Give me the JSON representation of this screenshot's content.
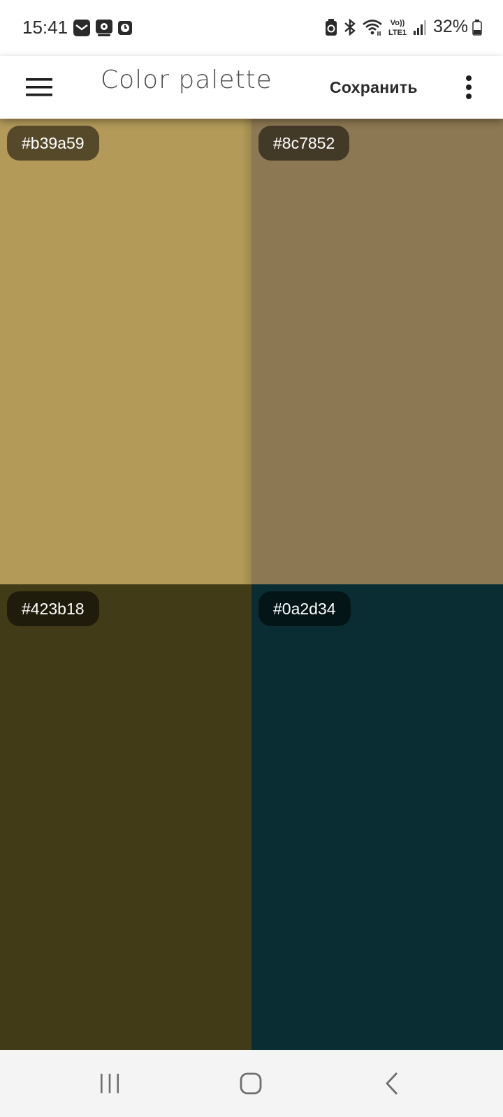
{
  "status_bar": {
    "time": "15:41",
    "left_icons": [
      "mail-icon",
      "gallery-icon",
      "clock-app-icon"
    ],
    "right_icons": [
      "battery-saver-icon",
      "bluetooth-icon",
      "wifi-icon",
      "volte-icon",
      "signal-icon",
      "battery-icon"
    ],
    "volte_label": "Vo)) LTE1",
    "battery": "32%"
  },
  "app_bar": {
    "menu_icon": "menu-icon",
    "title": "Color palette",
    "save_label": "Сохранить",
    "more_icon": "more-vert-icon"
  },
  "palette": {
    "colors": [
      {
        "hex_label": "#b39a59",
        "color": "#b39a59"
      },
      {
        "hex_label": "#8c7852",
        "color": "#8c7852"
      },
      {
        "hex_label": "#423b18",
        "color": "#423b18"
      },
      {
        "hex_label": "#0a2d34",
        "color": "#0a2d34"
      }
    ]
  },
  "nav_bar": {
    "buttons": [
      "recent-apps-icon",
      "home-icon",
      "back-icon"
    ]
  }
}
